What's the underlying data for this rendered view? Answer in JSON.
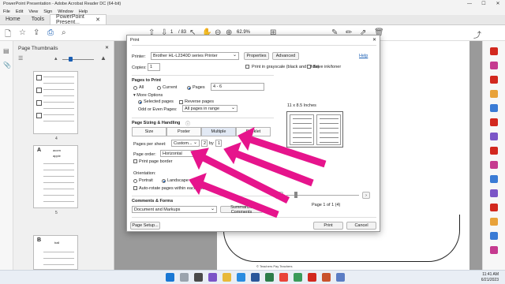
{
  "window": {
    "title": "PowerPoint Presentation - Adobe Acrobat Reader DC (64-bit)",
    "minimize": "—",
    "maximize": "☐",
    "close": "✕"
  },
  "menu": [
    "File",
    "Edit",
    "View",
    "Sign",
    "Window",
    "Help"
  ],
  "tabs": {
    "home": "Home",
    "tools": "Tools",
    "doc": "PowerPoint Present...",
    "doc_close": "✕"
  },
  "toolbar": {
    "page_current": "1",
    "page_total": "/ 83",
    "zoom": "62.9%"
  },
  "thumbnails": {
    "header": "Page Thumbnails",
    "close": "✕",
    "numbers": [
      "4",
      "5"
    ],
    "thumb_words": [
      "acorn",
      "apple",
      "ball"
    ]
  },
  "document": {
    "footer_text": "© Teachers Pay Teachers"
  },
  "dialog": {
    "title": "Print",
    "close": "✕",
    "printer_label": "Printer:",
    "printer_value": "Brother HL-L2340D series Printer",
    "properties": "Properties",
    "advanced": "Advanced",
    "help": "Help",
    "copies_label": "Copies:",
    "copies_value": "1",
    "grayscale": "Print in grayscale (black and white)",
    "save_ink": "Save ink/toner",
    "pages_header": "Pages to Print",
    "all": "All",
    "current": "Current",
    "pages": "Pages",
    "pages_value": "4 - 6",
    "more_options": "▾ More Options",
    "selected_pages": "Selected pages",
    "reverse_pages": "Reverse pages",
    "odd_even_label": "Odd or Even Pages:",
    "odd_even_value": "All pages in range",
    "sizing_header": "Page Sizing & Handling",
    "size": "Size",
    "poster": "Poster",
    "multiple": "Multiple",
    "booklet": "Booklet",
    "pages_per_sheet_label": "Pages per sheet:",
    "pages_per_sheet_value": "Custom...",
    "pps_a": "2",
    "pps_by": "by",
    "pps_b": "1",
    "page_order_label": "Page order:",
    "page_order_value": "Horizontal",
    "print_border": "Print page border",
    "orientation_label": "Orientation:",
    "portrait": "Portrait",
    "landscape": "Landscape",
    "auto_rotate": "Auto-rotate pages within each sheet",
    "comments_header": "Comments & Forms",
    "comments_value": "Document and Markups",
    "summarize": "Summarize Comments",
    "preview_size": "11 x 8.5 Inches",
    "preview_page": "Page 1 of 1 (4)",
    "prev": "‹",
    "next": "›",
    "page_setup": "Page Setup...",
    "print": "Print",
    "cancel": "Cancel"
  },
  "taskbar": {
    "time": "11:41 AM",
    "date": "6/21/2023"
  },
  "colors": {
    "arrow": "#e6148c",
    "accent": "#1a5fb4",
    "acrobat_red": "#d2281e"
  }
}
